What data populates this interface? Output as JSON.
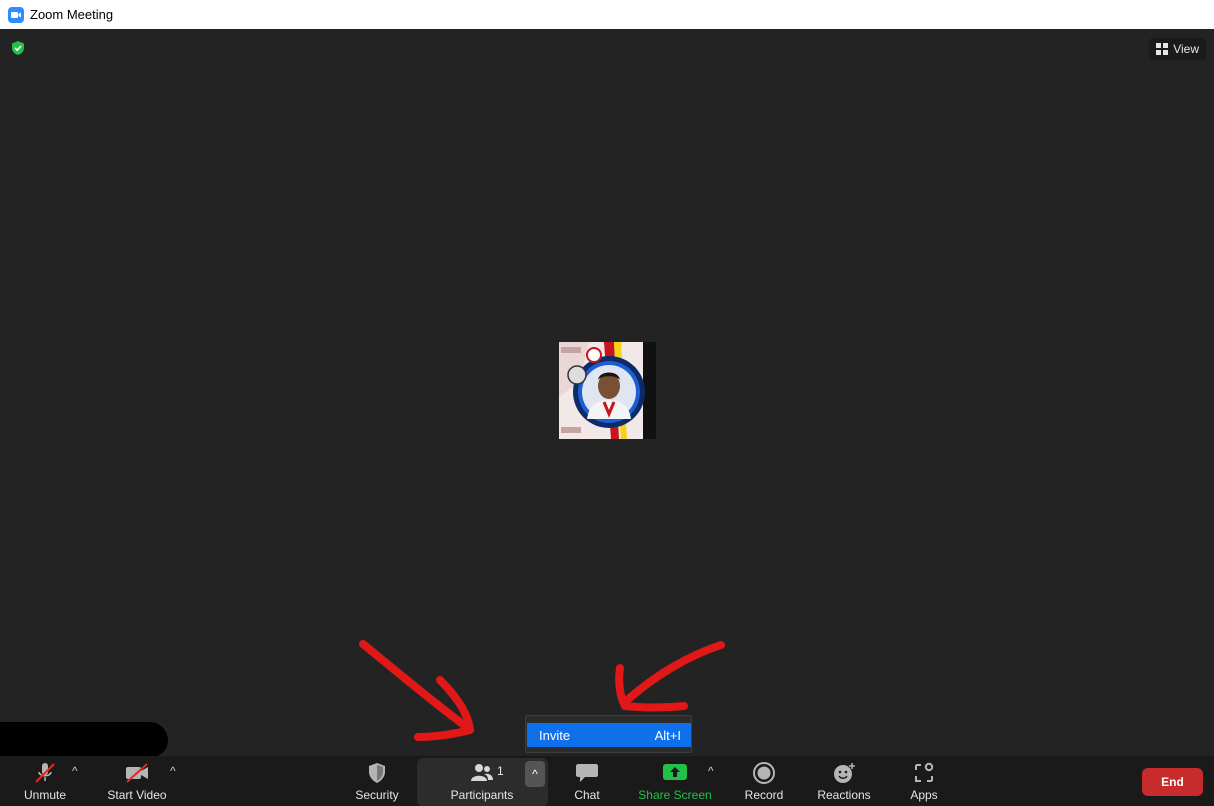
{
  "window": {
    "title": "Zoom Meeting",
    "icon": "zoom-camera-icon"
  },
  "meeting": {
    "view_label": "View",
    "security_indicator": "shield-check-icon",
    "accent": "#0e71eb"
  },
  "popup": {
    "items": [
      {
        "label": "Invite",
        "shortcut": "Alt+I"
      }
    ]
  },
  "toolbar": {
    "unmute": "Unmute",
    "start_video": "Start Video",
    "security": "Security",
    "participants": "Participants",
    "participant_count": "1",
    "chat": "Chat",
    "share_screen": "Share Screen",
    "record": "Record",
    "reactions": "Reactions",
    "apps": "Apps",
    "end": "End",
    "caret": "^"
  },
  "colors": {
    "end": "#c72b2b",
    "share": "#22c24a",
    "annotation": "#e01818"
  }
}
